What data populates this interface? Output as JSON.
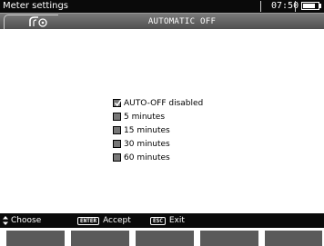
{
  "status_bar": {
    "title": "Meter settings",
    "time": "07:50"
  },
  "header": {
    "icon": "meter-settings-icon",
    "title": "AUTOMATIC OFF"
  },
  "options": [
    {
      "label": "AUTO-OFF disabled",
      "checked": true
    },
    {
      "label": "5 minutes",
      "checked": false
    },
    {
      "label": "15 minutes",
      "checked": false
    },
    {
      "label": "30 minutes",
      "checked": false
    },
    {
      "label": "60 minutes",
      "checked": false
    }
  ],
  "footer": {
    "choose_label": "Choose",
    "enter_key": "ENTER",
    "accept_label": "Accept",
    "esc_key": "ESC",
    "exit_label": "Exit"
  },
  "colors": {
    "bar": "#0a0a0a",
    "header_top": "#7a7a7a",
    "header_bottom": "#4f4f4f",
    "checkbox": "#777777",
    "softkey": "#5a5a5a"
  }
}
